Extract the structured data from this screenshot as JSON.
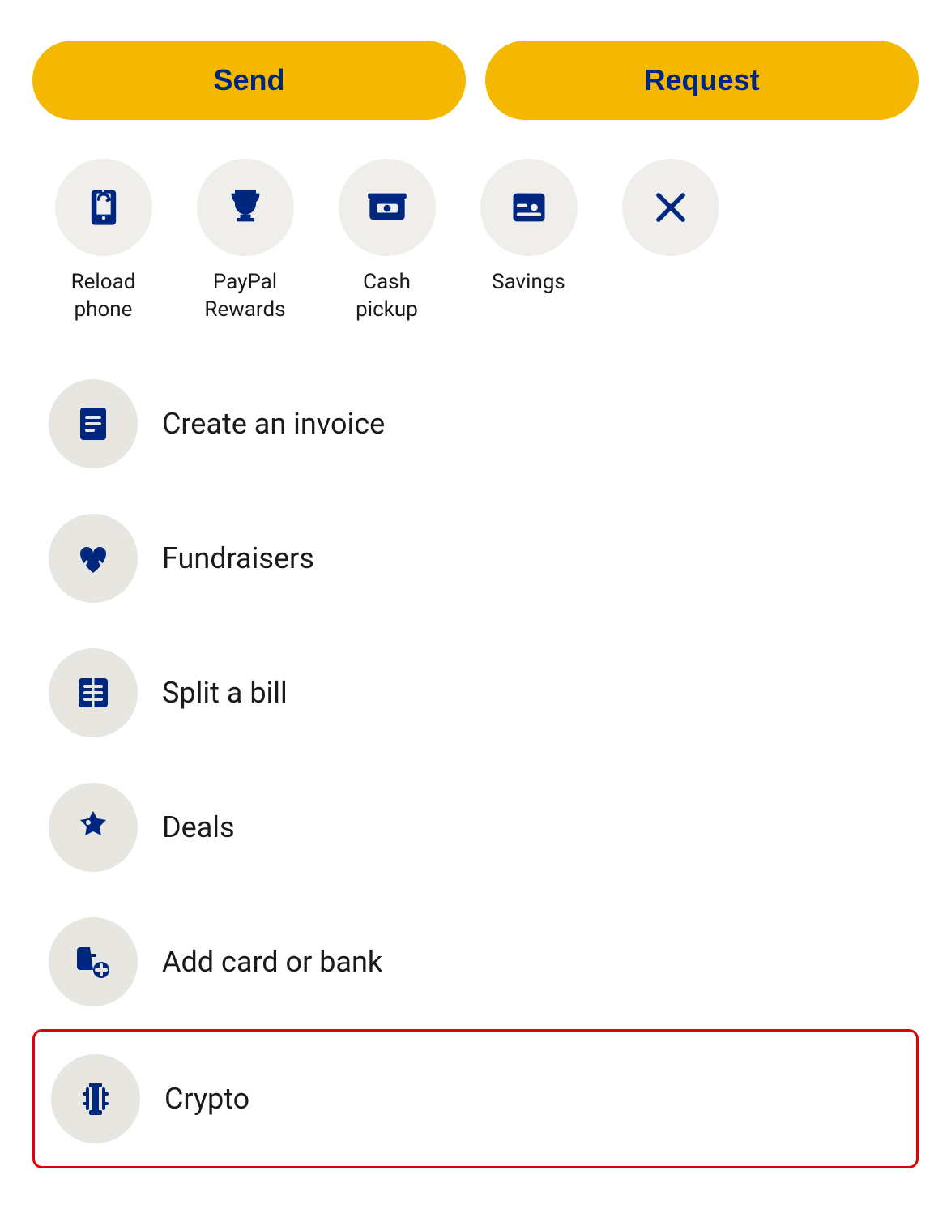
{
  "buttons": {
    "send": "Send",
    "request": "Request"
  },
  "iconGrid": {
    "items": [
      {
        "id": "reload-phone",
        "label": "Reload\nphone",
        "icon": "reload-phone-icon"
      },
      {
        "id": "paypal-rewards",
        "label": "PayPal\nRewards",
        "icon": "trophy-icon"
      },
      {
        "id": "cash-pickup",
        "label": "Cash\npickup",
        "icon": "cash-pickup-icon"
      },
      {
        "id": "savings",
        "label": "Savings",
        "icon": "savings-icon"
      },
      {
        "id": "close",
        "label": "",
        "icon": "close-icon"
      }
    ]
  },
  "listItems": [
    {
      "id": "create-invoice",
      "label": "Create an invoice",
      "icon": "invoice-icon",
      "highlighted": false
    },
    {
      "id": "fundraisers",
      "label": "Fundraisers",
      "icon": "fundraisers-icon",
      "highlighted": false
    },
    {
      "id": "split-bill",
      "label": "Split a bill",
      "icon": "split-bill-icon",
      "highlighted": false
    },
    {
      "id": "deals",
      "label": "Deals",
      "icon": "deals-icon",
      "highlighted": false
    },
    {
      "id": "add-card-or-bank",
      "label": "Add card or bank",
      "icon": "add-card-icon",
      "highlighted": false
    },
    {
      "id": "crypto",
      "label": "Crypto",
      "icon": "crypto-icon",
      "highlighted": true
    }
  ]
}
